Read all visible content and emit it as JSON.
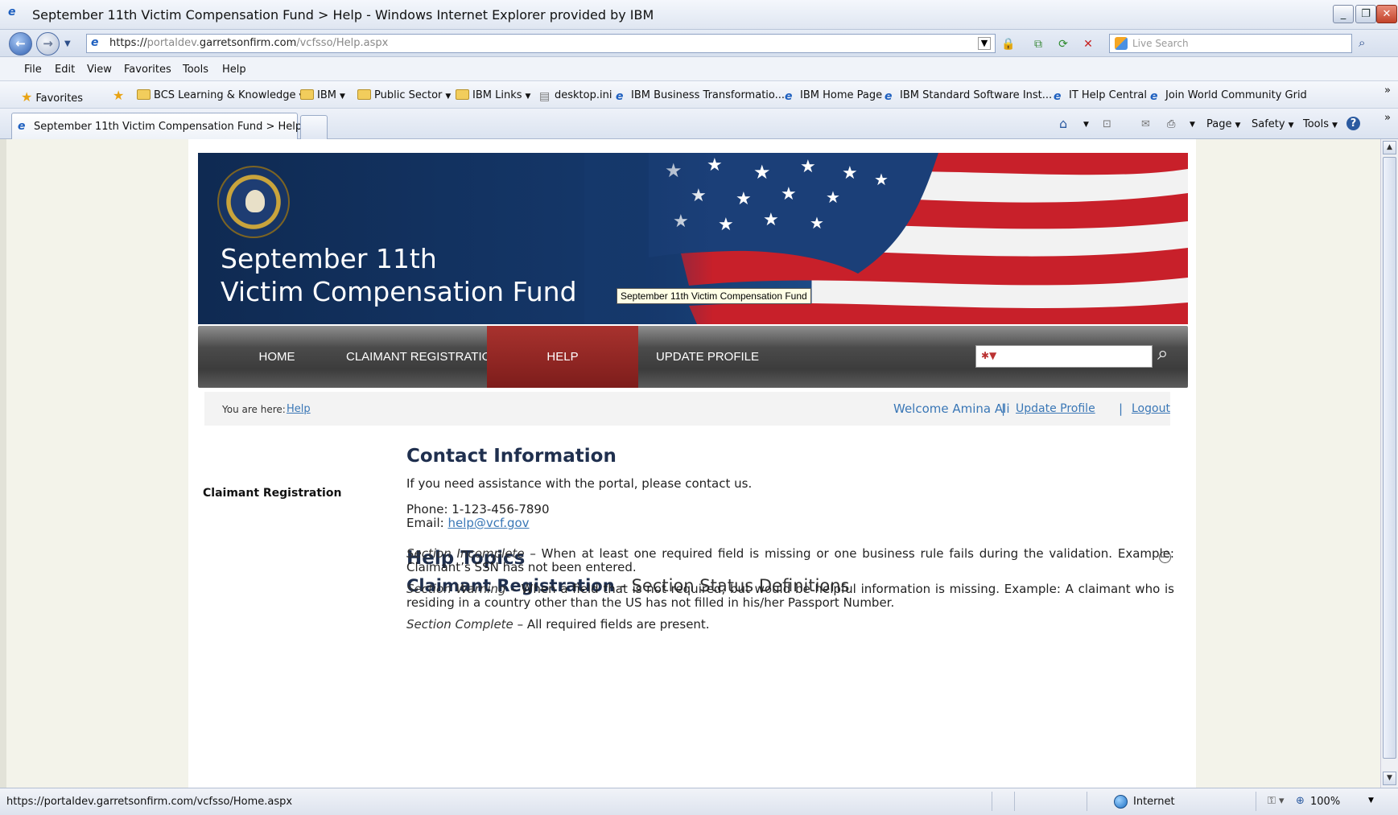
{
  "window": {
    "title": "September 11th Victim Compensation Fund > Help - Windows Internet Explorer provided by IBM",
    "minimize_glyph": "_",
    "restore_glyph": "❐",
    "close_glyph": "✕"
  },
  "address_bar": {
    "url_scheme": "https://",
    "url_host": "portaldev.",
    "url_domain": "garretsonfirm.com",
    "url_path": "/vcfsso/Help.aspx",
    "search_placeholder": "Live Search"
  },
  "menu": [
    "File",
    "Edit",
    "View",
    "Favorites",
    "Tools",
    "Help"
  ],
  "favorites_bar": {
    "favorites_label": "Favorites",
    "items": [
      {
        "label": "BCS Learning & Knowledge",
        "icon": "folder-icon",
        "dropdown": true
      },
      {
        "label": "IBM",
        "icon": "folder-icon",
        "dropdown": true
      },
      {
        "label": "Public Sector",
        "icon": "folder-icon",
        "dropdown": true
      },
      {
        "label": "IBM Links",
        "icon": "folder-icon",
        "dropdown": true
      },
      {
        "label": "desktop.ini",
        "icon": "file-icon",
        "dropdown": false
      },
      {
        "label": "IBM Business Transformatio...",
        "icon": "ie-page-icon",
        "dropdown": false
      },
      {
        "label": "IBM Home Page",
        "icon": "ie-page-icon",
        "dropdown": false
      },
      {
        "label": "IBM Standard Software Inst...",
        "icon": "ie-page-icon",
        "dropdown": false
      },
      {
        "label": "IT Help Central",
        "icon": "ie-page-icon",
        "dropdown": false
      },
      {
        "label": "Join World Community Grid",
        "icon": "ie-page-icon",
        "dropdown": false
      }
    ]
  },
  "tabs": {
    "active_label": "September 11th Victim Compensation Fund > Help"
  },
  "command_bar": {
    "page_label": "Page",
    "safety_label": "Safety",
    "tools_label": "Tools"
  },
  "site": {
    "title_line1": "September 11th",
    "title_line2": "Victim Compensation Fund",
    "tooltip": "September 11th Victim Compensation Fund",
    "nav": [
      "HOME",
      "CLAIMANT REGISTRATION",
      "HELP",
      "UPDATE PROFILE"
    ],
    "active_nav": "HELP",
    "breadcrumb_label": "You are here:",
    "breadcrumb_link": "Help",
    "welcome": "Welcome Amina Ali",
    "update_profile": "Update Profile",
    "logout": "Logout",
    "sidebar_item": "Claimant Registration"
  },
  "main": {
    "contact_heading": "Contact Information",
    "contact_intro": "If you need assistance with the portal, please contact us.",
    "phone": "Phone: 1-123-456-7890",
    "email_label": "Email:",
    "email": "help@vcf.gov",
    "help_heading": "Help Topics",
    "section_heading_bold": "Claimant Registration",
    "section_heading_rest": " - Section Status Definitions",
    "definitions": [
      {
        "term": "Section Incomplete",
        "text": " – When at least one required field is missing or one business rule fails during the validation.  Example: Claimant’s SSN has not been entered."
      },
      {
        "term": "Section Warning",
        "text": " – When a field that is not required, but would be helpful information is missing.  Example: A claimant who is residing in a country other than the US has not filled in his/her Passport Number."
      },
      {
        "term": "Section Complete",
        "text": " – All required fields are present."
      }
    ]
  },
  "status_bar": {
    "url": "https://portaldev.garretsonfirm.com/vcfsso/Home.aspx",
    "zone": "Internet",
    "zoom": "100%"
  }
}
